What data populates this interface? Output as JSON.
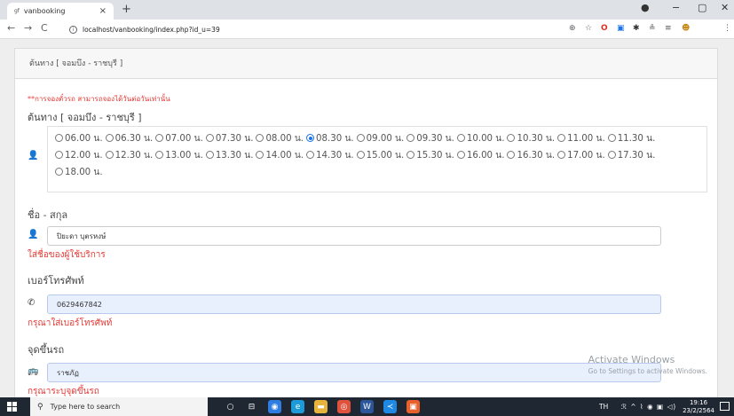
{
  "browser": {
    "tab_title": "vanbooking",
    "tab_favicon": "gf",
    "tab_close": "×",
    "new_tab": "+",
    "window_controls": [
      "●",
      "−",
      "▢",
      "✕"
    ],
    "nav": {
      "back": "←",
      "forward": "→",
      "reload": "C"
    },
    "url_info": "i",
    "url": "localhost/vanbooking/index.php?id_u=39",
    "toolbar_icons": [
      "⊕",
      "☆",
      "O",
      "▣",
      "✱",
      "≗",
      "≡",
      "☻",
      "⋮"
    ]
  },
  "page": {
    "header_title": "ต้นทาง [ จอมบึง - ราชบุรี ]",
    "notice": "**การจองตั๋วรถ สามารถจองได้วันต่อวันเท่านั้น",
    "route_title": "ต้นทาง [ จอมบึง - ราชบุรี ]",
    "times": [
      "06.00 น.",
      "06.30 น.",
      "07.00 น.",
      "07.30 น.",
      "08.00 น.",
      "08.30 น.",
      "09.00 น.",
      "09.30 น.",
      "10.00 น.",
      "10.30 น.",
      "11.00 น.",
      "11.30 น.",
      "12.00 น.",
      "12.30 น.",
      "13.00 น.",
      "13.30 น.",
      "14.00 น.",
      "14.30 น.",
      "15.00 น.",
      "15.30 น.",
      "16.00 น.",
      "16.30 น.",
      "17.00 น.",
      "17.30 น.",
      "18.00 น."
    ],
    "selected_time_index": 5,
    "name_label": "ชื่อ - สกุล",
    "name_value": "ปิยะดา บุตรหงษ์",
    "name_error": "ใส่ชื่อของผู้ใช้บริการ",
    "phone_label": "เบอร์โทรศัพท์",
    "phone_value": "0629467842",
    "phone_error": "กรุณาใส่เบอร์โทรศัพท์",
    "pickup_label": "จุดขึ้นรถ",
    "pickup_value": "ราชภัฏ",
    "pickup_error": "กรุณาระบุจุดขึ้นรถ",
    "icons": {
      "user": "👤",
      "phone": "✆",
      "bus": "🚌"
    },
    "watermark_title": "Activate Windows",
    "watermark_sub": "Go to Settings to activate Windows."
  },
  "taskbar": {
    "search_placeholder": "Type here to search",
    "search_icon": "⚲",
    "lang": "TH",
    "tray_symbols": "ℛ ^ ⌇ ◉ ▣ ◁)",
    "time": "19:16",
    "date": "23/2/2564",
    "app_icons": [
      {
        "name": "task-view-icon",
        "glyph": "○",
        "bg": "transparent"
      },
      {
        "name": "widgets-icon",
        "glyph": "⊟",
        "bg": "transparent"
      },
      {
        "name": "app-blue-icon",
        "glyph": "◉",
        "bg": "#2f7de1"
      },
      {
        "name": "edge-icon",
        "glyph": "e",
        "bg": "#1c9bd8"
      },
      {
        "name": "file-explorer-icon",
        "glyph": "▬",
        "bg": "#e8b33a"
      },
      {
        "name": "chrome-icon",
        "glyph": "◎",
        "bg": "#e0523c"
      },
      {
        "name": "word-icon",
        "glyph": "W",
        "bg": "#2b579a"
      },
      {
        "name": "vscode-icon",
        "glyph": "≺",
        "bg": "#1e88e5"
      },
      {
        "name": "app-orange-icon",
        "glyph": "▣",
        "bg": "#e8612c"
      }
    ]
  }
}
